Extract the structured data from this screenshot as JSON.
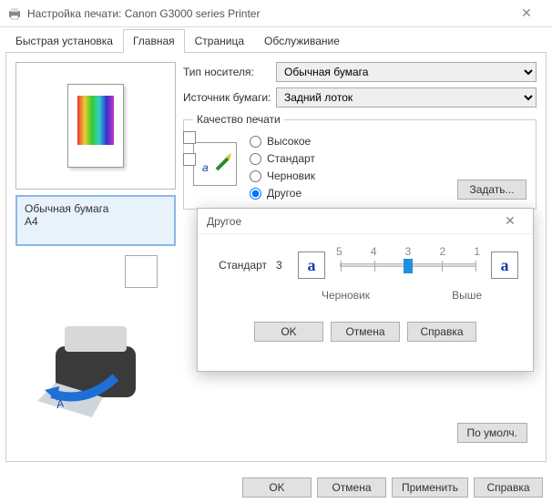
{
  "title": "Настройка печати: Canon G3000 series Printer",
  "tabs": [
    "Быстрая установка",
    "Главная",
    "Страница",
    "Обслуживание"
  ],
  "active_tab": 1,
  "labels": {
    "media_type": "Тип носителя:",
    "paper_source": "Источник бумаги:",
    "quality": "Качество печати"
  },
  "media_type_value": "Обычная бумага",
  "paper_source_value": "Задний лоток",
  "quality_options": [
    "Высокое",
    "Стандарт",
    "Черновик",
    "Другое"
  ],
  "quality_selected": 3,
  "set_button": "Задать...",
  "info": {
    "line1": "Обычная бумага",
    "line2": "A4"
  },
  "defaults_button": "По умолч.",
  "footer_buttons": [
    "OK",
    "Отмена",
    "Применить",
    "Справка"
  ],
  "dialog": {
    "title": "Другое",
    "slider_label": "Стандарт",
    "slider_value": "3",
    "ticks": [
      "5",
      "4",
      "3",
      "2",
      "1"
    ],
    "left_caption": "Черновик",
    "right_caption": "Выше",
    "letter": "a",
    "buttons": [
      "OK",
      "Отмена",
      "Справка"
    ]
  }
}
